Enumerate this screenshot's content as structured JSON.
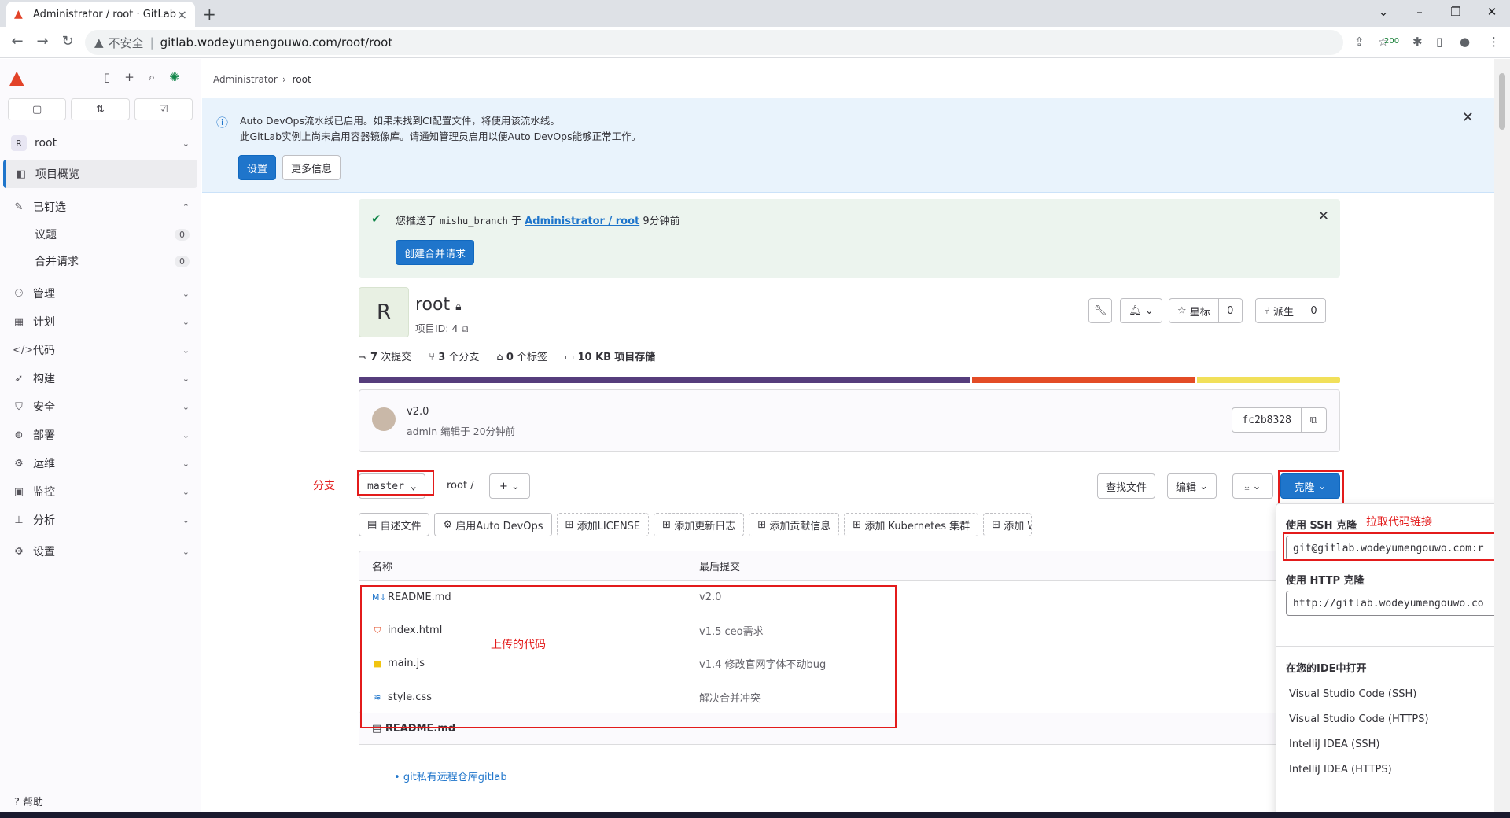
{
  "browser": {
    "tab_title": "Administrator / root · GitLab",
    "insecure_label": "不安全",
    "url": "gitlab.wodeyumengouwo.com/root/root",
    "ext_badge": "200"
  },
  "sidebar": {
    "project": "root",
    "project_initial": "R",
    "overview": "项目概览",
    "pinned": "已钉选",
    "pinned_items": [
      {
        "label": "议题",
        "count": "0"
      },
      {
        "label": "合并请求",
        "count": "0"
      }
    ],
    "sections": [
      "管理",
      "计划",
      "代码",
      "构建",
      "安全",
      "部署",
      "运维",
      "监控",
      "分析",
      "设置"
    ],
    "help": "帮助"
  },
  "breadcrumb": {
    "parent": "Administrator",
    "current": "root"
  },
  "devops_banner": {
    "line1": "Auto DevOps流水线已启用。如果未找到CI配置文件，将使用该流水线。",
    "line2": "此GitLab实例上尚未启用容器镜像库。请通知管理员启用以便Auto DevOps能够正常工作。",
    "settings_btn": "设置",
    "more_btn": "更多信息"
  },
  "push_alert": {
    "prefix": "您推送了",
    "branch": "mishu_branch",
    "mid": "于",
    "link": "Administrator / root",
    "suffix": "9分钟前",
    "button": "创建合并请求"
  },
  "project": {
    "initial": "R",
    "name": "root",
    "id_label": "项目ID: 4",
    "star_label": "星标",
    "star_count": "0",
    "fork_label": "派生",
    "fork_count": "0"
  },
  "stats": {
    "commits": "7",
    "commits_label": "次提交",
    "branches": "3",
    "branches_label": "个分支",
    "tags": "0",
    "tags_label": "个标签",
    "storage": "10 KB",
    "storage_label": "项目存储"
  },
  "languages": [
    {
      "color": "#563d7c",
      "pct": 62.5
    },
    {
      "color": "#e34c26",
      "pct": 22.9
    },
    {
      "color": "#f1e05a",
      "pct": 14.6
    }
  ],
  "last_commit": {
    "title": "v2.0",
    "meta": "admin 编辑于 20分钟前",
    "sha": "fc2b8328"
  },
  "repo_toolbar": {
    "branch": "master",
    "path": "root",
    "path_sep": "/",
    "find_file": "查找文件",
    "edit": "编辑",
    "clone": "克隆"
  },
  "quick_actions": [
    "自述文件",
    "启用Auto DevOps",
    "添加LICENSE",
    "添加更新日志",
    "添加贡献信息",
    "添加 Kubernetes 集群",
    "添加 W"
  ],
  "file_table": {
    "headers": [
      "名称",
      "最后提交"
    ],
    "rows": [
      {
        "name": "README.md",
        "commit": "v2.0",
        "icon": "markdown-icon",
        "color": "#1f75cb"
      },
      {
        "name": "index.html",
        "commit": "v1.5 ceo需求",
        "icon": "html-icon",
        "color": "#e34c26"
      },
      {
        "name": "main.js",
        "commit": "v1.4 修改官网字体不动bug",
        "icon": "js-icon",
        "color": "#f1c40f"
      },
      {
        "name": "style.css",
        "commit": "解决合并冲突",
        "icon": "css-icon",
        "color": "#1f75cb"
      }
    ]
  },
  "readme": {
    "title": "README.md",
    "item": "git私有远程仓库gitlab"
  },
  "clone_dropdown": {
    "ssh_label": "使用 SSH 克隆",
    "ssh_url": "git@gitlab.wodeyumengouwo.com:r",
    "http_label": "使用 HTTP 克隆",
    "http_url": "http://gitlab.wodeyumengouwo.co",
    "ide_label": "在您的IDE中打开",
    "ide_items": [
      "Visual Studio Code (SSH)",
      "Visual Studio Code (HTTPS)",
      "IntelliJ IDEA (SSH)",
      "IntelliJ IDEA (HTTPS)"
    ]
  },
  "annotations": {
    "branch": "分支",
    "clone_link": "拉取代码链接",
    "uploaded": "上传的代码"
  }
}
